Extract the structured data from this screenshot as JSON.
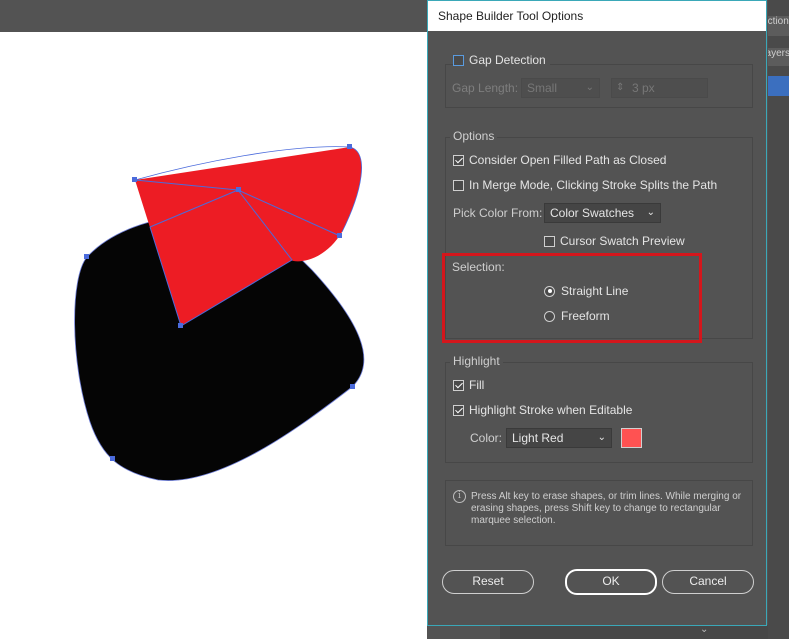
{
  "dialog": {
    "title": "Shape Builder Tool Options",
    "gap_detection": {
      "label": "Gap Detection",
      "checked": false,
      "gap_length_label": "Gap Length:",
      "gap_length_value": "Small",
      "custom_value": "3 px"
    },
    "options": {
      "legend": "Options",
      "consider_open_filled": {
        "label": "Consider Open Filled Path as Closed",
        "checked": true
      },
      "merge_mode_split": {
        "label": "In Merge Mode, Clicking Stroke Splits the Path",
        "checked": false
      },
      "pick_color_label": "Pick Color From:",
      "pick_color_value": "Color Swatches",
      "cursor_swatch_preview": {
        "label": "Cursor Swatch Preview",
        "checked": false
      }
    },
    "selection": {
      "legend": "Selection:",
      "straight_line": {
        "label": "Straight Line",
        "selected": true
      },
      "freeform": {
        "label": "Freeform",
        "selected": false
      }
    },
    "highlight": {
      "legend": "Highlight",
      "fill": {
        "label": "Fill",
        "checked": true
      },
      "highlight_stroke": {
        "label": "Highlight Stroke when Editable",
        "checked": true
      },
      "color_label": "Color:",
      "color_value": "Light Red",
      "swatch_color": "#ff5252"
    },
    "info_text": "Press Alt key to erase shapes, or trim lines. While merging or erasing shapes, press Shift key to change to rectangular marquee selection.",
    "buttons": {
      "reset": "Reset",
      "ok": "OK",
      "cancel": "Cancel"
    }
  },
  "right_panel": {
    "tab1": "Actions",
    "tab2": "Layers"
  },
  "colors": {
    "accent_red": "#ed1c24",
    "shape_black": "#050505",
    "anchor_blue": "#4b6bdc",
    "dialog_bg": "#535353",
    "highlight_box": "#d4161c"
  },
  "icons": {
    "info": "info-icon",
    "chevron": "chevron-down-icon",
    "stepper": "stepper-icon"
  }
}
